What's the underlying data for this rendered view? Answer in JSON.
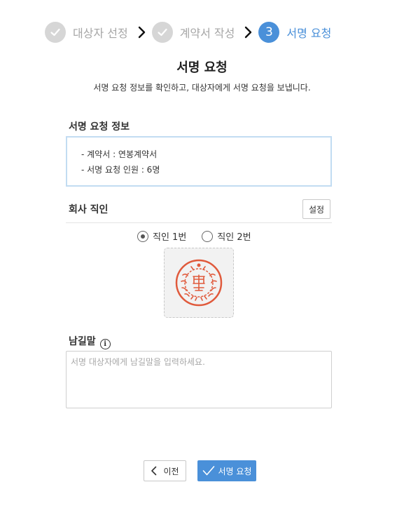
{
  "stepper": {
    "steps": [
      {
        "label": "대상자 선정",
        "state": "done",
        "icon": "check-icon"
      },
      {
        "label": "계약서 작성",
        "state": "done",
        "icon": "check-icon"
      },
      {
        "label": "서명 요청",
        "state": "active",
        "number": "3"
      }
    ],
    "separator_icon": "chevron-right-icon"
  },
  "page": {
    "title": "서명 요청",
    "subtitle": "서명 요청 정보를 확인하고, 대상자에게 서명 요청을 보냅니다."
  },
  "sign_info": {
    "heading": "서명 요청 정보",
    "lines": [
      "- 계약서 : 연봉계약서",
      "- 서명 요청 인원 : 6명"
    ]
  },
  "company_seal": {
    "heading": "회사 직인",
    "settings_label": "설정",
    "options": [
      {
        "label": "직인 1번",
        "selected": true
      },
      {
        "label": "직인 2번",
        "selected": false
      }
    ],
    "seal_image": "red-company-seal-stamp"
  },
  "message": {
    "heading": "남길말",
    "info_icon": "info-icon",
    "placeholder": "서명 대상자에게 남길말을 입력하세요.",
    "value": ""
  },
  "actions": {
    "prev_label": "이전",
    "submit_label": "서명 요청"
  },
  "colors": {
    "accent": "#4a90d9",
    "done_step": "#d6d6d6",
    "info_box_border": "#c2dcf2",
    "seal_red": "#e05a3c"
  }
}
